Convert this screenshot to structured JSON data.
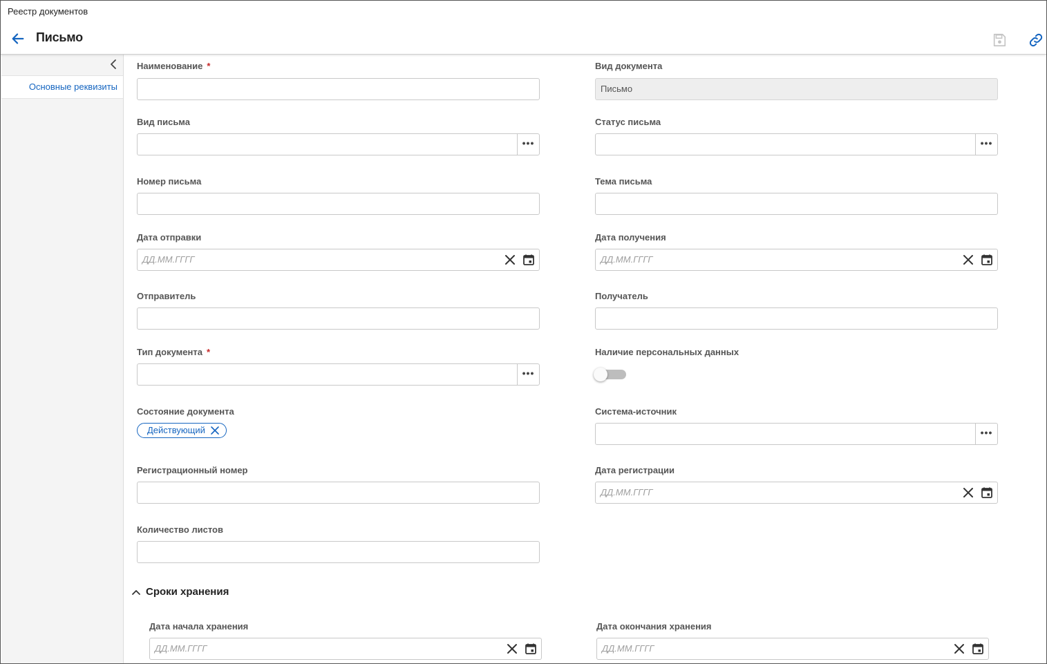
{
  "header": {
    "breadcrumb": "Реестр документов",
    "title": "Письмо"
  },
  "sidebar": {
    "items": [
      {
        "label": "Основные реквизиты"
      }
    ]
  },
  "form": {
    "name": {
      "label": "Наименование",
      "required": "*",
      "value": ""
    },
    "doc_kind": {
      "label": "Вид документа",
      "value": "Письмо"
    },
    "letter_kind": {
      "label": "Вид письма",
      "value": ""
    },
    "letter_status": {
      "label": "Статус письма",
      "value": ""
    },
    "letter_number": {
      "label": "Номер письма",
      "value": ""
    },
    "letter_subject": {
      "label": "Тема письма",
      "value": ""
    },
    "send_date": {
      "label": "Дата отправки",
      "placeholder": "ДД.ММ.ГГГГ"
    },
    "receive_date": {
      "label": "Дата получения",
      "placeholder": "ДД.ММ.ГГГГ"
    },
    "sender": {
      "label": "Отправитель",
      "value": ""
    },
    "recipient": {
      "label": "Получатель",
      "value": ""
    },
    "doc_type": {
      "label": "Тип документа",
      "required": "*",
      "value": ""
    },
    "personal_data": {
      "label": "Наличие персональных данных",
      "enabled": false
    },
    "doc_state": {
      "label": "Состояние документа",
      "chip": "Действующий"
    },
    "source_system": {
      "label": "Система-источник",
      "value": ""
    },
    "reg_number": {
      "label": "Регистрационный номер",
      "value": ""
    },
    "reg_date": {
      "label": "Дата регистрации",
      "placeholder": "ДД.ММ.ГГГГ"
    },
    "sheet_count": {
      "label": "Количество листов",
      "value": ""
    }
  },
  "storage": {
    "title": "Сроки хранения",
    "start_date": {
      "label": "Дата начала хранения",
      "placeholder": "ДД.ММ.ГГГГ"
    },
    "end_date": {
      "label": "Дата окончания хранения",
      "placeholder": "ДД.ММ.ГГГГ"
    }
  },
  "icons": {
    "back": "arrow-left-icon",
    "save": "save-icon",
    "link": "link-icon",
    "collapse": "chevron-left-icon",
    "lookup": "more-horizontal-icon",
    "clear": "close-icon",
    "calendar": "calendar-icon",
    "section": "chevron-up-icon"
  },
  "colors": {
    "accent": "#1565c0",
    "required": "#c62828",
    "readonly_bg": "#eeeeee"
  }
}
